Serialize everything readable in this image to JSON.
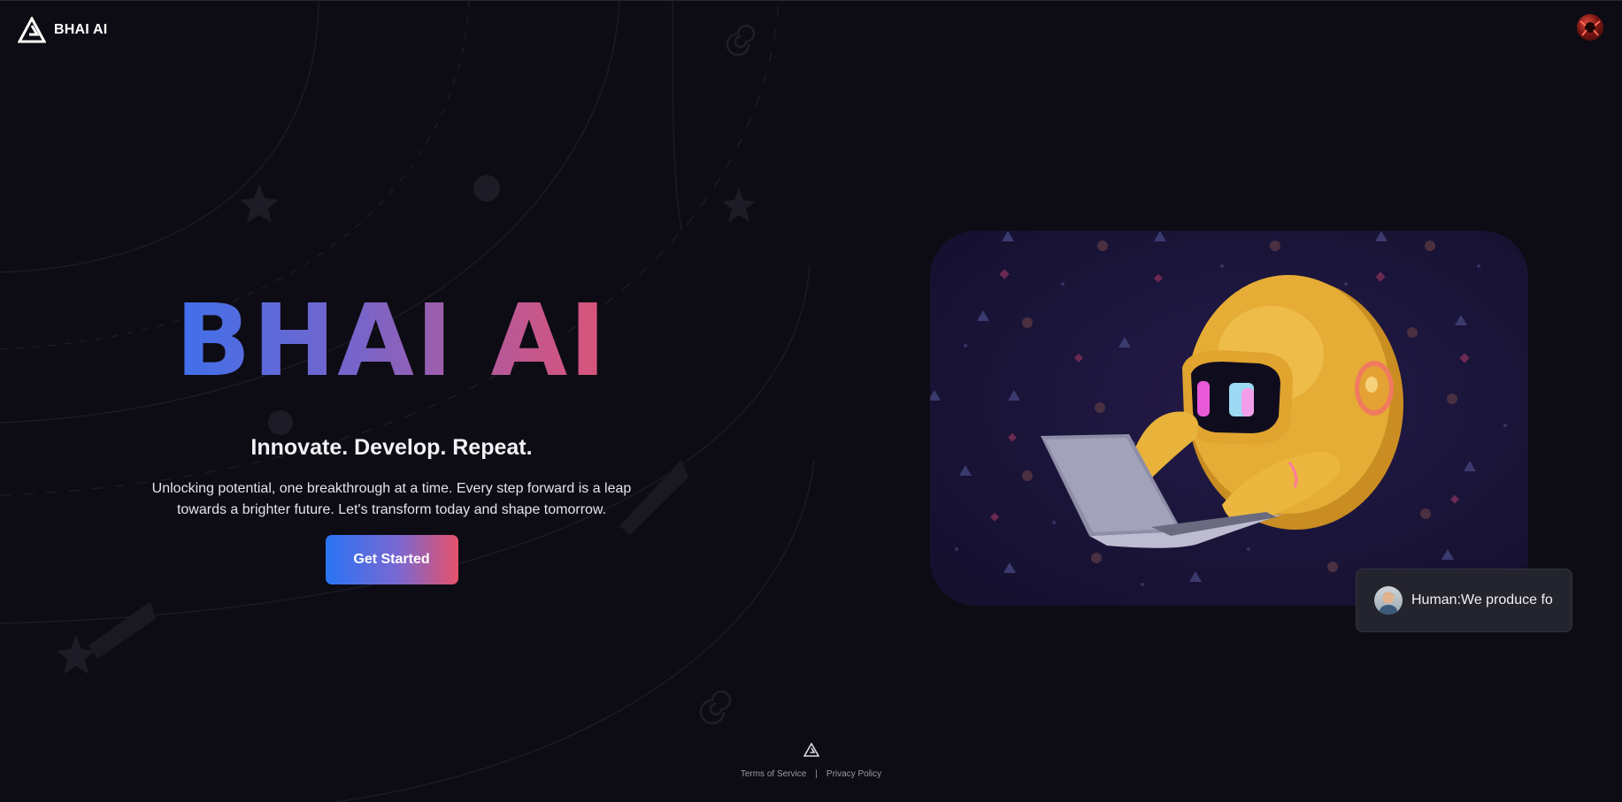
{
  "header": {
    "brand_name": "BHAI AI",
    "logo_icon": "triangle-logo-icon",
    "user_avatar": "user-avatar"
  },
  "hero": {
    "title": "BHAI AI",
    "tagline": "Innovate. Develop. Repeat.",
    "description": "Unlocking potential, one breakthrough at a time. Every step forward is a leap towards a brighter future. Let's transform today and shape tomorrow.",
    "cta_label": "Get Started"
  },
  "illustration": {
    "subject": "yellow-robot-with-laptop-icon"
  },
  "chat_bubble": {
    "text": "Human:We produce fo"
  },
  "footer": {
    "terms_label": "Terms of Service",
    "separator": "|",
    "privacy_label": "Privacy Policy"
  },
  "colors": {
    "background": "#0d0c14",
    "gradient_start": "#2f73f5",
    "gradient_end": "#e6546c",
    "card_background": "#1a1438",
    "robot_yellow": "#e9b43a"
  }
}
